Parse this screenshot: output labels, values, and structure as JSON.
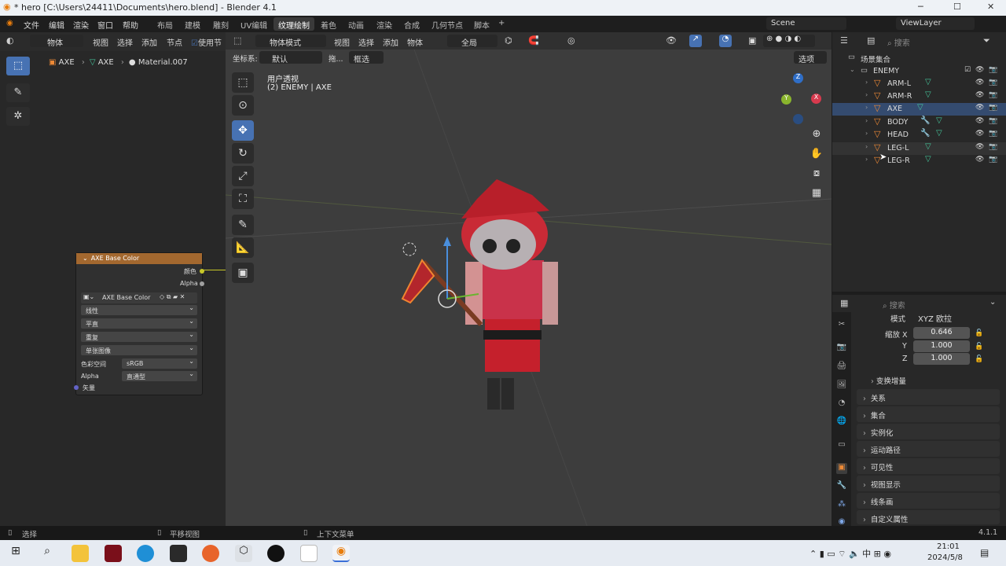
{
  "window": {
    "title": "* hero [C:\\Users\\24411\\Documents\\hero.blend] - Blender 4.1",
    "minimize": "─",
    "maximize": "☐",
    "close": "✕"
  },
  "menu": {
    "file": "文件",
    "edit": "编辑",
    "render": "渲染",
    "window": "窗口",
    "help": "帮助"
  },
  "workspaces": [
    "布局",
    "建模",
    "雕刻",
    "UV编辑",
    "纹理绘制",
    "着色",
    "动画",
    "渲染",
    "合成",
    "几何节点",
    "脚本"
  ],
  "active_workspace": "纹理绘制",
  "add_tab": "+",
  "scene": {
    "label": "Scene",
    "view_layer": "ViewLayer"
  },
  "left_header": {
    "mode": "物体",
    "view": "视图",
    "select": "选择",
    "add": "添加",
    "node": "节点",
    "use_nodes": "使用节"
  },
  "left_breadcrumb": {
    "obj": "AXE",
    "mesh": "AXE",
    "material": "Material.007"
  },
  "node": {
    "title": "AXE Base Color",
    "out_color": "颜色",
    "out_alpha": "Alpha",
    "image_name": "AXE Base Color",
    "interp": "线性",
    "proj": "平直",
    "ext": "重复",
    "source": "单张图像",
    "colorspace_label": "色彩空间",
    "colorspace": "sRGB",
    "alpha_label": "Alpha",
    "alpha_mode": "直通型",
    "vector": "矢量"
  },
  "viewport_header": {
    "mode": "物体模式",
    "view": "视图",
    "select": "选择",
    "add": "添加",
    "object": "物体",
    "transform": "全局",
    "coord_label": "坐标系:",
    "coord_value": "默认",
    "drag": "拖...",
    "select_mode": "框选",
    "options": "选项"
  },
  "viewport": {
    "persp": "用户透视",
    "info": "(2) ENEMY | AXE",
    "gizmo_z": "Z",
    "gizmo_x": "X",
    "gizmo_y": "Y"
  },
  "outliner": {
    "search": "搜索",
    "scene_collection": "场景集合",
    "collection": "ENEMY",
    "objects": [
      {
        "name": "ARM-L",
        "mod": false
      },
      {
        "name": "ARM-R",
        "mod": false
      },
      {
        "name": "AXE",
        "mod": false
      },
      {
        "name": "BODY",
        "mod": true
      },
      {
        "name": "HEAD",
        "mod": true
      },
      {
        "name": "LEG-L",
        "mod": false
      },
      {
        "name": "LEG-R",
        "mod": false
      }
    ],
    "selected": "AXE"
  },
  "properties": {
    "search": "搜索",
    "mode_label": "模式",
    "mode_value": "XYZ 欧拉",
    "scale_x_label": "缩放 X",
    "scale_x": "0.646",
    "scale_y_label": "Y",
    "scale_y": "1.000",
    "scale_z_label": "Z",
    "scale_z": "1.000",
    "delta": "变换增量",
    "sections": [
      "关系",
      "集合",
      "实例化",
      "运动路径",
      "可见性",
      "视图显示",
      "线条画",
      "自定义属性"
    ]
  },
  "status": {
    "select": "选择",
    "pan": "平移视图",
    "context": "上下文菜单",
    "version": "4.1.1"
  },
  "taskbar": {
    "time": "21:01",
    "date": "2024/5/8"
  },
  "colors": {
    "accent": "#4772b3",
    "node_header": "#a3682f",
    "object_orange": "#ee8a36",
    "mesh_green": "#45c49a"
  }
}
